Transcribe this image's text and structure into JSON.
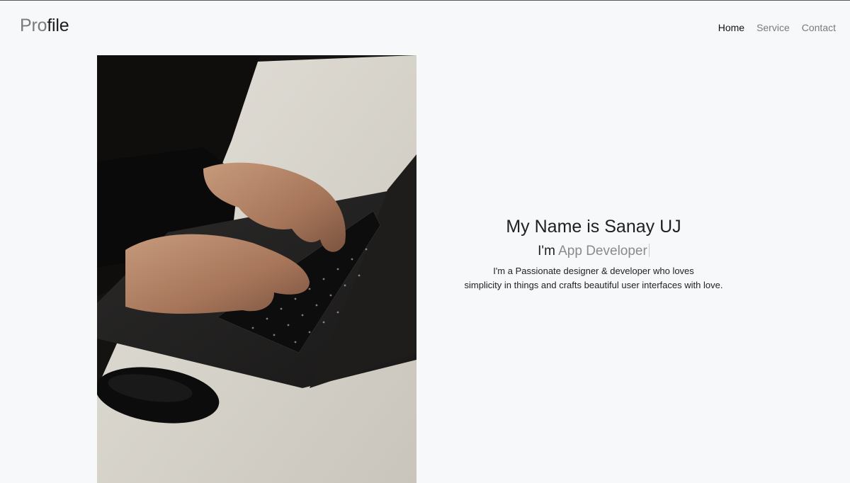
{
  "brand": {
    "part1": "Pro",
    "part2": "file"
  },
  "nav": {
    "items": [
      {
        "label": "Home",
        "active": true
      },
      {
        "label": "Service",
        "active": false
      },
      {
        "label": "Contact",
        "active": false
      }
    ]
  },
  "hero": {
    "image_alt": "Hands typing on a laptop keyboard beside a mouse",
    "name_line": "My Name is Sanay UJ",
    "role_prefix": "I'm ",
    "role_text": "App Developer",
    "bio_line1": "I'm a Passionate designer & developer who loves",
    "bio_line2": "simplicity in things and crafts beautiful user interfaces with love."
  },
  "colors": {
    "background": "#f7f8fa",
    "brand_light": "#7b7b7b",
    "brand_dark": "#1d1d1d",
    "nav_inactive": "#7a7a7a",
    "nav_active": "#111111",
    "role_accent": "#8a8a8a"
  }
}
